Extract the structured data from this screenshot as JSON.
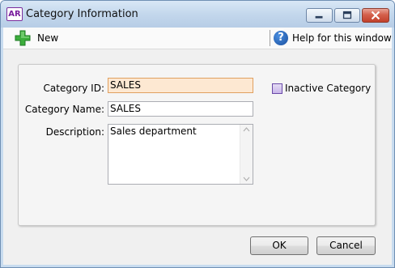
{
  "window": {
    "app_badge": "AR",
    "title": "Category Information"
  },
  "toolbar": {
    "new_label": "New",
    "help_label": "Help for this window"
  },
  "form": {
    "category_id_label": "Category ID:",
    "category_id_value": "SALES",
    "category_name_label": "Category Name:",
    "category_name_value": "SALES",
    "description_label": "Description:",
    "description_value": "Sales department",
    "inactive_label": "Inactive Category",
    "inactive_checked": false
  },
  "buttons": {
    "ok": "OK",
    "cancel": "Cancel"
  },
  "colors": {
    "active_field_bg": "#fde8d2",
    "close_button": "#c2402b"
  }
}
